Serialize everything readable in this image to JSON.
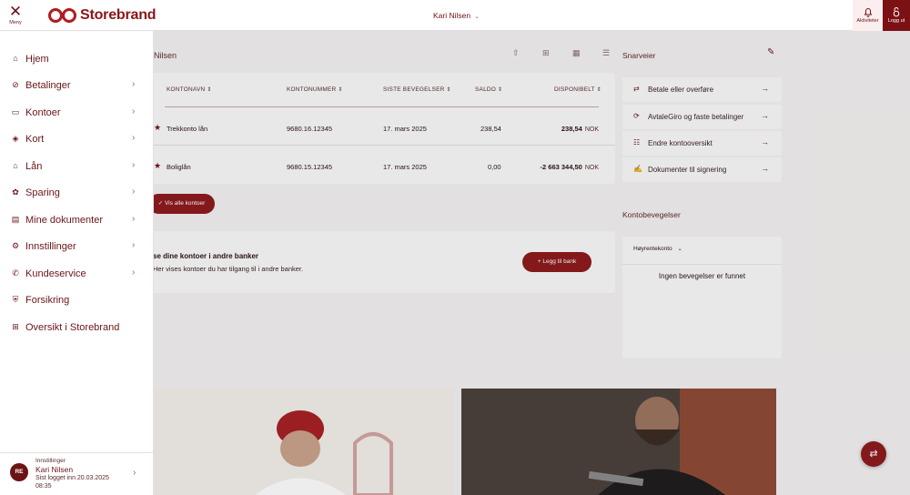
{
  "header": {
    "menu_icon": "close-icon",
    "menu_label": "Meny",
    "logo_text": "Storebrand",
    "user_name": "Kari Nilsen",
    "activity_label": "Aktiviteter",
    "logout_label": "Logg ut"
  },
  "accounts": {
    "title_fragment": "Nilsen",
    "columns": [
      "KONTONAVN",
      "KONTONUMMER",
      "SISTE BEVEGELSER",
      "SALDO",
      "DISPONIBELT"
    ],
    "rows": [
      {
        "name": "Trekkonto lån",
        "number": "9680.16.12345",
        "last": "17. mars 2025",
        "saldo": "238,54",
        "available": "238,54",
        "currency": "NOK"
      },
      {
        "name": "Boliglån",
        "number": "9680.15.12345",
        "last": "17. mars 2025",
        "saldo": "0,00",
        "available": "-2 663 344,50",
        "currency": "NOK"
      }
    ],
    "show_all_label": "Vis alle kontoer"
  },
  "banks": {
    "title_fragment": "se dine kontoer i andre banker",
    "subtitle_fragment": "Her vises kontoer du har tilgang til i andre banker.",
    "add_label": "Legg til bank"
  },
  "shortcuts": {
    "title": "Snarveier",
    "items": [
      {
        "icon": "transfer-icon",
        "label": "Betale eller overføre"
      },
      {
        "icon": "recurring-icon",
        "label": "AvtaleGiro og faste betalinger"
      },
      {
        "icon": "edit-list-icon",
        "label": "Endre kontooversikt"
      },
      {
        "icon": "sign-document-icon",
        "label": "Dokumenter til signering"
      }
    ]
  },
  "movements": {
    "title": "Kontobevegelser",
    "selected_account": "Høyrentekonto",
    "empty_text": "Ingen bevegelser er funnet"
  },
  "menu": {
    "items": [
      {
        "icon": "home-icon",
        "label": "Hjem",
        "has_sub": false
      },
      {
        "icon": "payment-icon",
        "label": "Betalinger",
        "has_sub": true
      },
      {
        "icon": "wallet-icon",
        "label": "Kontoer",
        "has_sub": true
      },
      {
        "icon": "card-icon",
        "label": "Kort",
        "has_sub": true
      },
      {
        "icon": "loan-icon",
        "label": "Lån",
        "has_sub": true
      },
      {
        "icon": "savings-icon",
        "label": "Sparing",
        "has_sub": true
      },
      {
        "icon": "documents-icon",
        "label": "Mine dokumenter",
        "has_sub": true
      },
      {
        "icon": "settings-icon",
        "label": "Innstillinger",
        "has_sub": true
      },
      {
        "icon": "phone-icon",
        "label": "Kundeservice",
        "has_sub": true
      },
      {
        "icon": "insurance-icon",
        "label": "Forsikring",
        "has_sub": false
      },
      {
        "icon": "grid-icon",
        "label": "Oversikt i Storebrand",
        "has_sub": false
      }
    ],
    "footer": {
      "settings_label": "Innstillinger",
      "initials": "RE",
      "name": "Kari Nilsen",
      "last_login": "Sist logget inn 20.03.2025 08:35"
    }
  },
  "colors": {
    "brand": "#8d1a1c",
    "brand_dark": "#6b1416"
  }
}
